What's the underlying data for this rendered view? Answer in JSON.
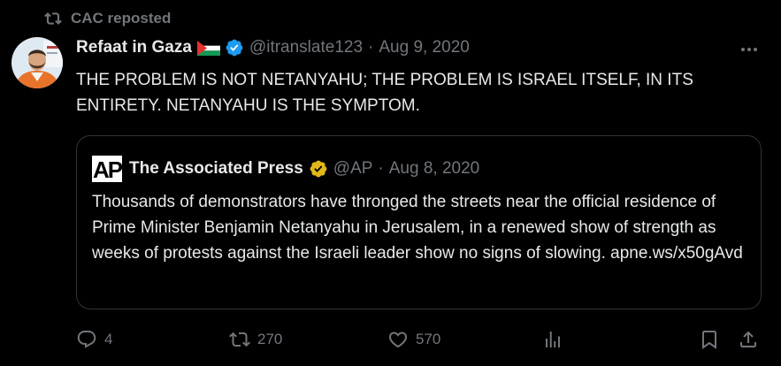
{
  "repost": {
    "label": "CAC reposted"
  },
  "post": {
    "display_name": "Refaat in Gaza",
    "handle": "@itranslate123",
    "separator": "·",
    "date": "Aug 9, 2020",
    "text": "THE PROBLEM IS NOT NETANYAHU; THE PROBLEM IS ISRAEL ITSELF, IN ITS ENTIRETY. NETANYAHU IS THE SYMPTOM.",
    "verified_color": "#1d9bf0",
    "icons": {
      "flag": "palestine-flag",
      "verified": "verified-badge",
      "more": "more-options"
    }
  },
  "quote": {
    "display_name": "The Associated Press",
    "handle": "@AP",
    "separator": "·",
    "date": "Aug 8, 2020",
    "text": "Thousands of demonstrators have thronged the streets near the official residence of Prime Minister Benjamin Netanyahu in Jerusalem, in a renewed show of strength as weeks of protests against the Israeli leader show no signs of slowing. apne.ws/x50gAvd",
    "logo_text": "AP",
    "verified_color": "#e2b719"
  },
  "actions": {
    "replies": "4",
    "reposts": "270",
    "likes": "570",
    "icons": [
      "reply",
      "repost",
      "like",
      "views",
      "bookmark",
      "share"
    ]
  },
  "colors": {
    "background": "#000000",
    "text": "#e7e9ea",
    "muted": "#71767b",
    "border": "#2f3336"
  }
}
